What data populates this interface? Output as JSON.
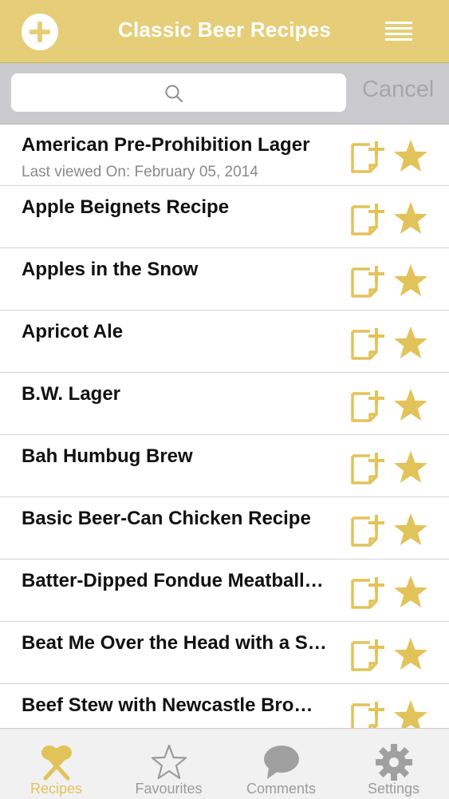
{
  "header": {
    "title": "Classic Beer Recipes",
    "add_icon": "plus-circle-icon",
    "menu_icon": "menu-lines-icon"
  },
  "search": {
    "placeholder": "",
    "value": "",
    "icon": "search-icon",
    "cancel_label": "Cancel"
  },
  "recipes": [
    {
      "name": "American Pre-Prohibition Lager",
      "subtitle": "Last viewed On: February 05, 2014"
    },
    {
      "name": "Apple Beignets Recipe",
      "subtitle": ""
    },
    {
      "name": "Apples in the Snow",
      "subtitle": ""
    },
    {
      "name": "Apricot Ale",
      "subtitle": ""
    },
    {
      "name": "B.W. Lager",
      "subtitle": ""
    },
    {
      "name": "Bah Humbug Brew",
      "subtitle": ""
    },
    {
      "name": "Basic Beer-Can Chicken Recipe",
      "subtitle": ""
    },
    {
      "name": "Batter-Dipped Fondue Meatball…",
      "subtitle": ""
    },
    {
      "name": "Beat Me Over the Head with a S…",
      "subtitle": ""
    },
    {
      "name": "Beef Stew with Newcastle Bro…",
      "subtitle": ""
    }
  ],
  "row_icons": {
    "note": "add-note-icon",
    "favourite": "star-icon"
  },
  "tabs": [
    {
      "label": "Recipes",
      "icon": "spoon-fork-icon",
      "active": true
    },
    {
      "label": "Favourites",
      "icon": "star-outline-icon",
      "active": false
    },
    {
      "label": "Comments",
      "icon": "speech-bubble-icon",
      "active": false
    },
    {
      "label": "Settings",
      "icon": "gear-icon",
      "active": false
    }
  ],
  "colors": {
    "accent": "#e6cd78",
    "icon_gold": "#e2c35a",
    "search_bg": "#cbcbcf",
    "tab_inactive": "#9c9c9c"
  }
}
